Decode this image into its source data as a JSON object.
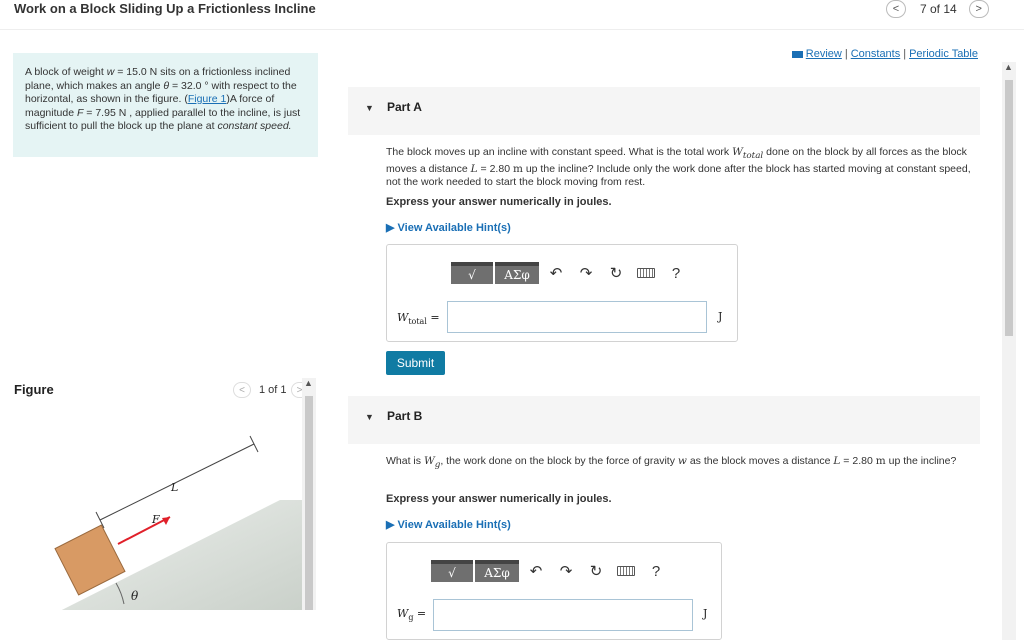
{
  "header": {
    "title": "Work on a Block Sliding Up a Frictionless Incline",
    "pager_text": "7 of 14",
    "prev_icon": "chevron-left-icon",
    "next_icon": "chevron-right-icon"
  },
  "problem": {
    "t1": "A block of weight ",
    "w_sym": "w",
    "t2": " = 15.0 ",
    "w_unit": "N",
    "t3": " sits on a frictionless inclined plane, which makes an angle ",
    "theta_sym": "θ",
    "t4": " = 32.0 ° with respect to the horizontal, as shown in the figure. (",
    "figure_link": "Figure 1",
    "t5": ")A force of magnitude ",
    "f_sym": "F",
    "t6": " = 7.95 ",
    "f_unit": "N",
    "t7": " , applied parallel to the incline, is just sufficient to pull the block up the plane at ",
    "t8_italic": "constant speed."
  },
  "figure": {
    "label": "Figure",
    "pager_text": "1 of 1",
    "label_L": "L",
    "label_F": "F",
    "label_theta": "θ"
  },
  "links": {
    "review": "Review",
    "constants": "Constants",
    "periodic_table": "Periodic Table",
    "sep": "|"
  },
  "part_a": {
    "label": "Part A",
    "q1": "The block moves up an incline with constant speed. What is the total work ",
    "q_var": "W",
    "q_sub": "total",
    "q2": " done on the block by all forces as the block moves a distance ",
    "q_L": "L",
    "q3": " = 2.80 ",
    "q_unit": "m",
    "q4": " up the incline? Include only the work done after the block has started moving at constant speed, not the work needed to start the block moving from rest.",
    "express": "Express your answer numerically in joules.",
    "hints": "View Available Hint(s)",
    "var_main": "W",
    "var_sub": "total",
    "eq": " =",
    "unit": "J",
    "submit": "Submit"
  },
  "part_b": {
    "label": "Part B",
    "q1": "What is ",
    "q_var": "W",
    "q_sub": "g",
    "q2": ", the work done on the block by the force of gravity ",
    "q_w": "w",
    "q3": " as the block moves a distance ",
    "q_L": "L",
    "q4": " = 2.80 ",
    "q_unit": "m",
    "q5": " up the incline?",
    "express": "Express your answer numerically in joules.",
    "hints": "View Available Hint(s)",
    "var_main": "W",
    "var_sub": "g",
    "eq": " =",
    "unit": "J"
  },
  "toolbar": {
    "templates_label": "√",
    "symbols_label": "ΑΣφ",
    "undo": "↶",
    "redo": "↷",
    "reset": "↻",
    "help": "?"
  },
  "colors": {
    "accent": "#107ba3",
    "link": "#1a6fb5",
    "problem_bg": "#e5f4f4",
    "block": "#d89a64",
    "arrow": "#e0202a",
    "incline": "#c8cfc8"
  }
}
